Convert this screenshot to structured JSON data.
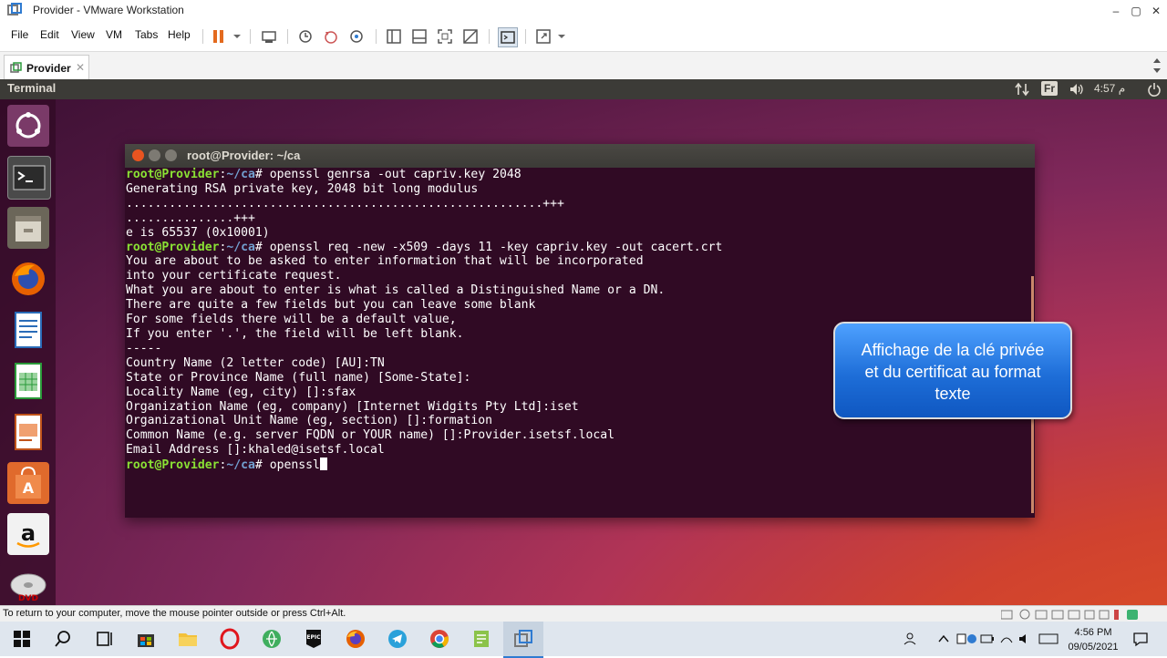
{
  "window": {
    "title": "Provider - VMware Workstation",
    "controls": [
      "–",
      "▢",
      "✕"
    ]
  },
  "menubar": {
    "items": [
      "File",
      "Edit",
      "View",
      "VM",
      "Tabs",
      "Help"
    ]
  },
  "tab": {
    "label": "Provider",
    "close": "✕"
  },
  "ubuntu_panel": {
    "app_name": "Terminal",
    "keyboard": "Fr",
    "clock": "م 4:57"
  },
  "terminal": {
    "title": "root@Provider: ~/ca",
    "user_host": "root@Provider",
    "path": "~/ca",
    "commands": [
      "openssl genrsa -out capriv.key 2048",
      "openssl req -new -x509 -days 11 -key capriv.key -out cacert.crt",
      "openssl"
    ],
    "output1": [
      "Generating RSA private key, 2048 bit long modulus",
      "..........................................................+++",
      "...............+++",
      "e is 65537 (0x10001)"
    ],
    "output2": [
      "You are about to be asked to enter information that will be incorporated",
      "into your certificate request.",
      "What you are about to enter is what is called a Distinguished Name or a DN.",
      "There are quite a few fields but you can leave some blank",
      "For some fields there will be a default value,",
      "If you enter '.', the field will be left blank.",
      "-----",
      "Country Name (2 letter code) [AU]:TN",
      "State or Province Name (full name) [Some-State]:",
      "Locality Name (eg, city) []:sfax",
      "Organization Name (eg, company) [Internet Widgits Pty Ltd]:iset",
      "Organizational Unit Name (eg, section) []:formation",
      "Common Name (e.g. server FQDN or YOUR name) []:Provider.isetsf.local",
      "Email Address []:khaled@isetsf.local"
    ]
  },
  "callout": {
    "line1": "Affichage de la clé privée",
    "line2": "et du certificat au format",
    "line3": "texte"
  },
  "statusbar": {
    "hint": "To return to your computer, move the mouse pointer outside or press Ctrl+Alt."
  },
  "taskbar": {
    "time": "4:56 PM",
    "date": "09/05/2021"
  },
  "colors": {
    "terminal_bg": "#300a24",
    "prompt_green": "#8ae234",
    "path_blue": "#729fcf",
    "callout_blue": "#1e6ed8"
  }
}
